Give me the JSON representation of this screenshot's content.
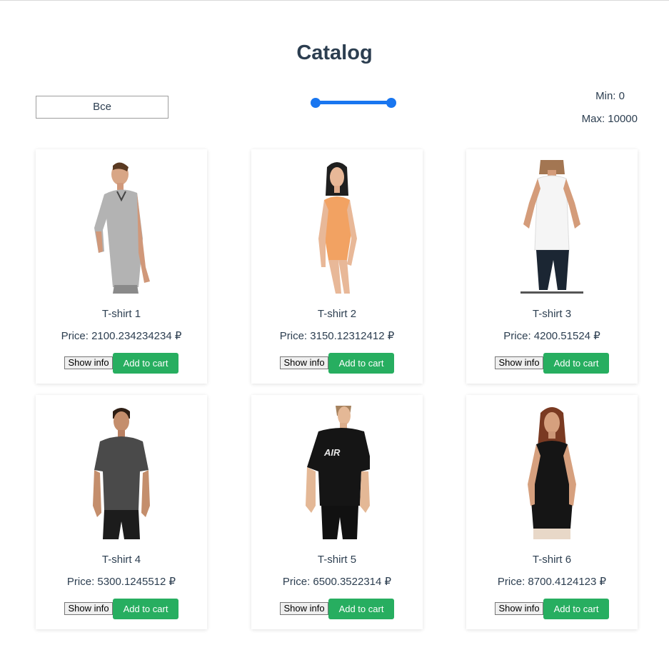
{
  "page": {
    "title": "Catalog"
  },
  "filters": {
    "category_selected": "Все",
    "min_label": "Min: 0",
    "max_label": "Max: 10000",
    "range_min": 0,
    "range_max": 10000,
    "accent_color": "#1976f0"
  },
  "products": [
    {
      "name": "T-shirt 1",
      "price": "Price: 2100.234234234 ₽",
      "show_info": "Show info",
      "add_to_cart": "Add to cart",
      "image": "man-grey-tshirt"
    },
    {
      "name": "T-shirt 2",
      "price": "Price: 3150.12312412 ₽",
      "show_info": "Show info",
      "add_to_cart": "Add to cart",
      "image": "woman-orange-bodysuit"
    },
    {
      "name": "T-shirt 3",
      "price": "Price: 4200.51524 ₽",
      "show_info": "Show info",
      "add_to_cart": "Add to cart",
      "image": "woman-white-tank"
    },
    {
      "name": "T-shirt 4",
      "price": "Price: 5300.1245512 ₽",
      "show_info": "Show info",
      "add_to_cart": "Add to cart",
      "image": "man-dark-tshirt"
    },
    {
      "name": "T-shirt 5",
      "price": "Price: 6500.3522314 ₽",
      "show_info": "Show info",
      "add_to_cart": "Add to cart",
      "image": "woman-black-tshirt"
    },
    {
      "name": "T-shirt 6",
      "price": "Price: 8700.4124123 ₽",
      "show_info": "Show info",
      "add_to_cart": "Add to cart",
      "image": "woman-black-top"
    }
  ],
  "colors": {
    "button_green": "#27ae60",
    "text": "#2c3e50"
  }
}
